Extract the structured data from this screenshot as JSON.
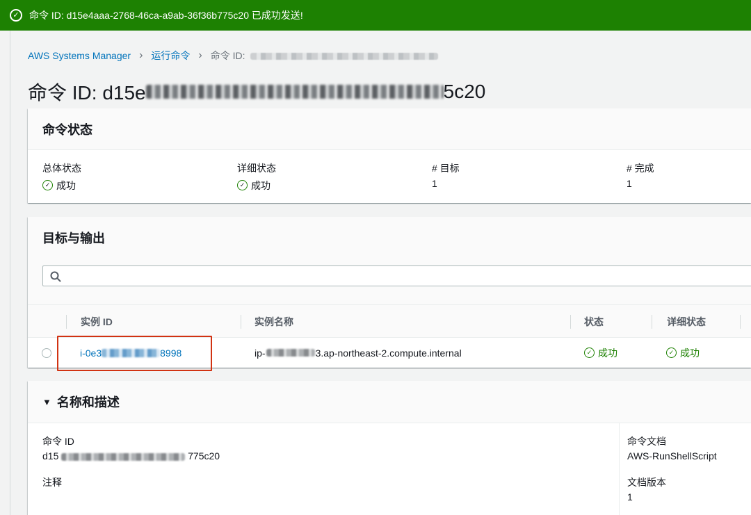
{
  "flash": {
    "message": "命令 ID: d15e4aaa-2768-46ca-a9ab-36f36b775c20 已成功发送!",
    "color": "#1d8102"
  },
  "breadcrumb": {
    "items": [
      "AWS Systems Manager",
      "运行命令"
    ],
    "current_prefix": "命令 ID:"
  },
  "page": {
    "title_prefix": "命令 ID: d15e",
    "title_suffix": "5c20"
  },
  "command_status": {
    "heading": "命令状态",
    "fields": [
      {
        "label": "总体状态",
        "value": "成功",
        "status": true
      },
      {
        "label": "详细状态",
        "value": "成功",
        "status": true
      },
      {
        "label": "# 目标",
        "value": "1",
        "status": false
      },
      {
        "label": "# 完成",
        "value": "1",
        "status": false
      }
    ]
  },
  "targets": {
    "heading": "目标与输出",
    "search": {
      "placeholder": ""
    },
    "columns": [
      "实例 ID",
      "实例名称",
      "状态",
      "详细状态"
    ],
    "rows": [
      {
        "instance_id_prefix": "i-0e3",
        "instance_id_suffix": "8998",
        "instance_name_prefix": "ip-",
        "instance_name_suffix": "3.ap-northeast-2.compute.internal",
        "status": "成功",
        "detail_status": "成功"
      }
    ]
  },
  "description": {
    "heading": "名称和描述",
    "command_id_label": "命令 ID",
    "command_id_prefix": "d15",
    "command_id_suffix": "775c20",
    "comment_label": "注释",
    "document_label": "命令文档",
    "document_value": "AWS-RunShellScript",
    "doc_version_label": "文档版本",
    "doc_version_value": "1"
  },
  "colors": {
    "success": "#1d8102",
    "link": "#0073bb",
    "highlight": "#d13212"
  }
}
